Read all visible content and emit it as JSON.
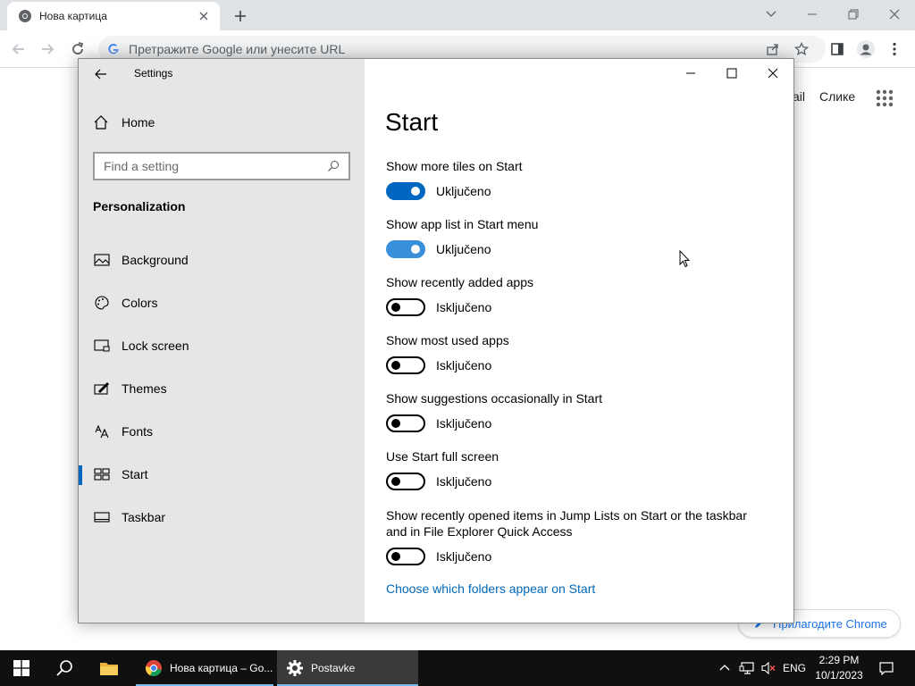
{
  "chrome": {
    "tab_title": "Нова картица",
    "omnibox_placeholder": "Претражите Google или унесите URL",
    "links": {
      "gmail": "ail",
      "images": "Слике"
    },
    "customize_label": "Прилагодите Chrome"
  },
  "settings": {
    "window_title": "Settings",
    "home_label": "Home",
    "search_placeholder": "Find a setting",
    "section": "Personalization",
    "nav": [
      {
        "label": "Background",
        "icon": "picture-icon"
      },
      {
        "label": "Colors",
        "icon": "palette-icon"
      },
      {
        "label": "Lock screen",
        "icon": "lock-screen-icon"
      },
      {
        "label": "Themes",
        "icon": "brush-icon"
      },
      {
        "label": "Fonts",
        "icon": "font-icon"
      },
      {
        "label": "Start",
        "icon": "start-icon",
        "selected": true
      },
      {
        "label": "Taskbar",
        "icon": "taskbar-icon"
      }
    ],
    "page_title": "Start",
    "options": [
      {
        "label": "Show more tiles on Start",
        "state": "Uključeno",
        "on": true
      },
      {
        "label": "Show app list in Start menu",
        "state": "Uključeno",
        "on": true
      },
      {
        "label": "Show recently added apps",
        "state": "Isključeno",
        "on": false
      },
      {
        "label": "Show most used apps",
        "state": "Isključeno",
        "on": false
      },
      {
        "label": "Show suggestions occasionally in Start",
        "state": "Isključeno",
        "on": false
      },
      {
        "label": "Use Start full screen",
        "state": "Isključeno",
        "on": false
      },
      {
        "label_line1": "Show recently opened items in Jump Lists on Start or the taskbar",
        "label_line2": "and in File Explorer Quick Access",
        "state": "Isključeno",
        "on": false
      }
    ],
    "folders_link": "Choose which folders appear on Start"
  },
  "taskbar": {
    "chrome_item": "Нова картица – Go...",
    "settings_item": "Postavke",
    "language": "ENG",
    "time": "2:29 PM",
    "date": "10/1/2023"
  },
  "colors": {
    "accent": "#0067c0",
    "link": "#0067b8",
    "sidebar_bg": "#e6e6e6",
    "taskbar_bg": "#101010"
  }
}
